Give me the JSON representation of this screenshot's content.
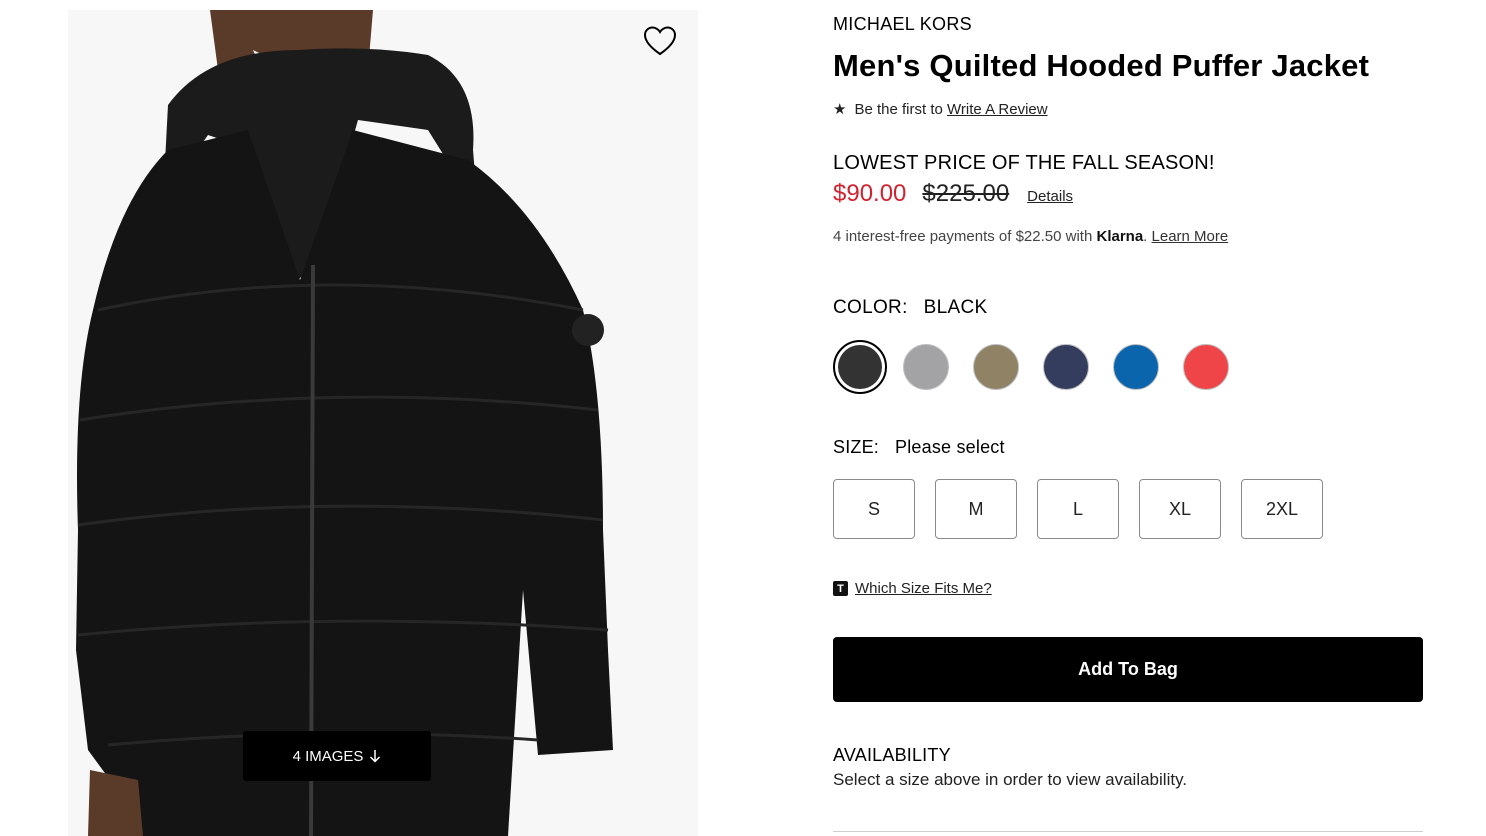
{
  "gallery": {
    "images_button_label": "4 IMAGES",
    "images_button_icon": "arrow-down-icon",
    "wishlist_icon": "heart-icon"
  },
  "product": {
    "brand": "MICHAEL KORS",
    "title": "Men's Quilted Hooded Puffer Jacket"
  },
  "review": {
    "star": "★",
    "prefix": "Be the first to",
    "link": "Write A Review"
  },
  "pricing": {
    "promo": "LOWEST PRICE OF THE FALL SEASON!",
    "sale_price": "$90.00",
    "original_price": "$225.00",
    "details_link": "Details",
    "sale_color": "#d1222f"
  },
  "klarna": {
    "text": "4 interest-free payments of $22.50 with",
    "brand": "Klarna",
    "period": ".",
    "learn_more": "Learn More"
  },
  "color": {
    "label": "COLOR:",
    "selected": "BLACK",
    "swatches": [
      {
        "name": "black",
        "hex": "#333333",
        "selected": true
      },
      {
        "name": "grey",
        "hex": "#a3a3a5",
        "selected": false
      },
      {
        "name": "khaki",
        "hex": "#8f8265",
        "selected": false
      },
      {
        "name": "navy",
        "hex": "#343d5e",
        "selected": false
      },
      {
        "name": "blue",
        "hex": "#0b65ad",
        "selected": false
      },
      {
        "name": "red",
        "hex": "#ef4549",
        "selected": false
      }
    ]
  },
  "size": {
    "label": "SIZE:",
    "selected": "Please select",
    "options": [
      "S",
      "M",
      "L",
      "XL",
      "2XL"
    ]
  },
  "fit": {
    "badge": "T",
    "link": "Which Size Fits Me?"
  },
  "cart": {
    "add_label": "Add To Bag"
  },
  "availability": {
    "title": "AVAILABILITY",
    "text": "Select a size above in order to view availability."
  }
}
